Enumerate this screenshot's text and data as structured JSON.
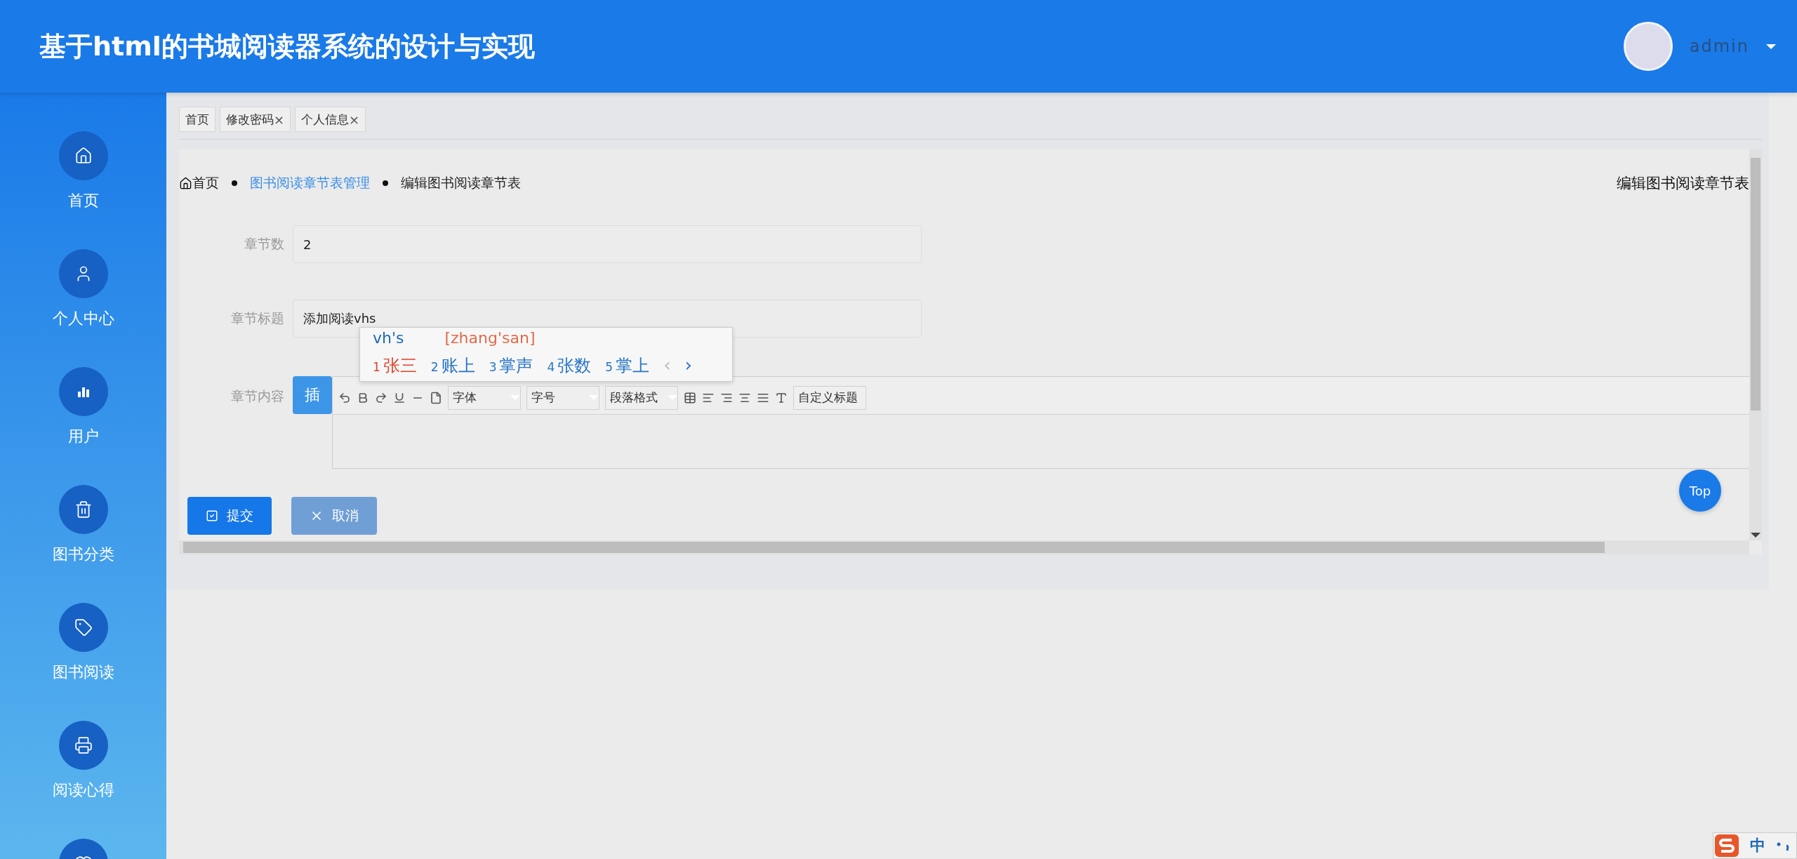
{
  "header": {
    "title": "基于html的书城阅读器系统的设计与实现",
    "user": "admin"
  },
  "sidebar": {
    "items": [
      {
        "label": "首页"
      },
      {
        "label": "个人中心"
      },
      {
        "label": "用户"
      },
      {
        "label": "图书分类"
      },
      {
        "label": "图书阅读"
      },
      {
        "label": "阅读心得"
      },
      {
        "kind": "icon_only"
      }
    ]
  },
  "tabs": [
    {
      "label": "首页"
    },
    {
      "label": "修改密码",
      "close": "×"
    },
    {
      "label": "个人信息",
      "close": "×"
    }
  ],
  "breadcrumb": {
    "items": [
      {
        "label": "首页",
        "kind": "home"
      },
      {
        "label": "图书阅读章节表管理",
        "kind": "link"
      },
      {
        "label": "编辑图书阅读章节表",
        "kind": "current"
      }
    ],
    "page_title": "编辑图书阅读章节表"
  },
  "form": {
    "fields": [
      {
        "label": "章节数",
        "value": "2"
      },
      {
        "label": "章节标题",
        "value": "添加阅读vhs"
      }
    ],
    "editor": {
      "label": "章节内容",
      "insert_button": "插",
      "selects": [
        "字体",
        "字号",
        "段落格式"
      ],
      "heading_select": "自定义标题"
    }
  },
  "buttons": [
    {
      "label": "提交",
      "kind": "primary"
    },
    {
      "label": "取消",
      "kind": "secondary"
    }
  ],
  "back_to_top": "Top",
  "ime": {
    "composition": "vh's",
    "pinyin": "[zhang'san]",
    "candidates": [
      {
        "number": "1",
        "text": "张三",
        "selected": true
      },
      {
        "number": "2",
        "text": "账上",
        "selected": false
      },
      {
        "number": "3",
        "text": "掌声",
        "selected": false
      },
      {
        "number": "4",
        "text": "张数",
        "selected": false
      },
      {
        "number": "5",
        "text": "掌上",
        "selected": false
      }
    ],
    "prev": "‹",
    "next": "›"
  },
  "ime_status": {
    "mode": "中"
  }
}
